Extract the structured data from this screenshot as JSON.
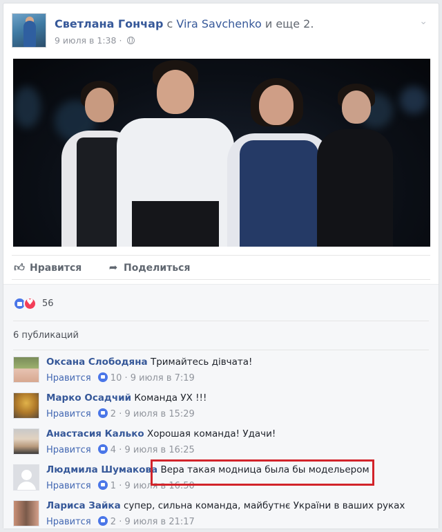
{
  "post": {
    "author": "Светлана Гончар",
    "with_word": "с",
    "tagged": "Vira Savchenko",
    "and_more": "и еще 2.",
    "date": "9 июля в 1:38",
    "separator": "·"
  },
  "actions": {
    "like_label": "Нравится",
    "share_label": "Поделиться"
  },
  "reactions": {
    "count": "56"
  },
  "shares": {
    "label": "6 публикаций"
  },
  "comments": [
    {
      "name": "Оксана Слободяна",
      "text": "Тримайтесь дівчата!",
      "like": "Нравится",
      "dot": "·",
      "likes": "10",
      "time": "9 июля в 7:19"
    },
    {
      "name": "Марко Осадчий",
      "text": "Команда УХ !!!",
      "like": "Нравится",
      "dot": "·",
      "likes": "2",
      "time": "9 июля в 15:29"
    },
    {
      "name": "Анастасия Калько",
      "text": "Хорошая команда! Удачи!",
      "like": "Нравится",
      "dot": "·",
      "likes": "4",
      "time": "9 июля в 16:25"
    },
    {
      "name": "Людмила Шумакова",
      "text": "Вера такая модница была бы модельером",
      "like": "Нравится",
      "dot": "·",
      "likes": "1",
      "time": "9 июля в 16:50"
    },
    {
      "name": "Лариса Зайка",
      "text": "супер, сильна команда, майбутнє України в ваших руках",
      "like": "Нравится",
      "dot": "·",
      "likes": "2",
      "time": "9 июля в 21:17"
    }
  ],
  "colors": {
    "link": "#365899",
    "highlight": "#d2232a",
    "like_blue": "#4a76e8",
    "love_red": "#f33e58"
  }
}
